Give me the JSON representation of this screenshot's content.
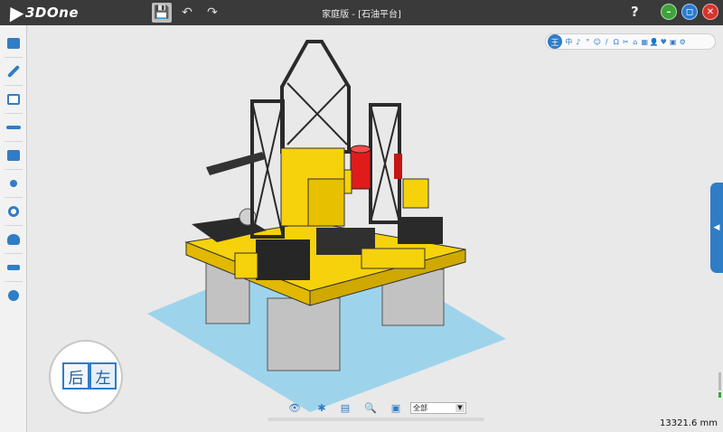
{
  "app": {
    "logo_text": "3DOne",
    "window_title": "家庭版 - [石油平台]"
  },
  "quick_access": [
    {
      "name": "save",
      "glyph": "💾"
    },
    {
      "name": "undo",
      "glyph": "↶"
    },
    {
      "name": "redo",
      "glyph": "↷"
    }
  ],
  "window_controls": {
    "help": "?",
    "minimize": "–",
    "maximize": "◻",
    "close": "✕"
  },
  "left_toolbar": [
    "basic-solid-icon",
    "sketch-icon",
    "sketch-edit-icon",
    "feature-icon",
    "modify-icon",
    "transform-icon",
    "magnet-icon",
    "combine-icon",
    "distance-icon",
    "render-icon"
  ],
  "right_toolbar": {
    "first": "王",
    "items": [
      "中",
      "♪",
      "°",
      "☺",
      "/",
      "Ω",
      "✂",
      "⌂",
      "▦",
      "👤",
      "♥",
      "▣",
      "⚙"
    ]
  },
  "view_cube": {
    "face_back": "后",
    "face_left": "左"
  },
  "collapse_tab": {
    "arrow": "◀"
  },
  "bottom_toolbar": {
    "tools": [
      "👁",
      "✱",
      "▤",
      "🔍",
      "▣"
    ],
    "filter": {
      "value": "全部",
      "arrow": "▼"
    }
  },
  "status": {
    "zoom": "13321.6 mm"
  },
  "colors": {
    "accent": "#2f7dc7",
    "titlebar": "#3a3a3a",
    "model_yellow": "#f5d20c",
    "model_dark": "#2a2a2a",
    "ground": "#8fd0ec"
  }
}
